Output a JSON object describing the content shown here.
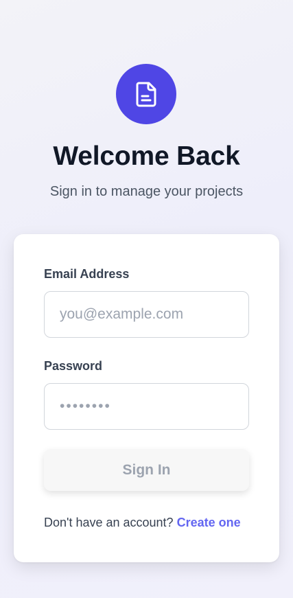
{
  "header": {
    "logo_icon": "document-icon",
    "title": "Welcome Back",
    "subtitle": "Sign in to manage your projects"
  },
  "form": {
    "email": {
      "label": "Email Address",
      "placeholder": "you@example.com",
      "value": ""
    },
    "password": {
      "label": "Password",
      "placeholder": "••••••••",
      "value": ""
    },
    "submit_label": "Sign In"
  },
  "footer": {
    "prompt": "Don't have an account?",
    "link_label": "Create one"
  },
  "colors": {
    "accent": "#4f46e5",
    "link": "#6366f1",
    "button_bg": "#f7f7f7",
    "button_text": "#9ca3af"
  }
}
